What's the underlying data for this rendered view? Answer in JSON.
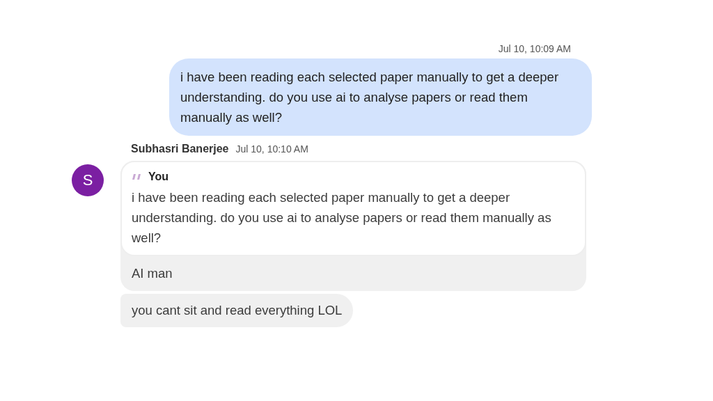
{
  "outgoing": {
    "time": "Jul 10, 10:09 AM",
    "text": "i have been reading each selected paper manually to get a deeper understanding. do you use ai to analyse papers or read them manually as well?"
  },
  "incoming": {
    "avatar_letter": "S",
    "sender": "Subhasri Banerjee",
    "time": "Jul 10, 10:10 AM",
    "quote": {
      "author": "You",
      "text": "i have been reading each selected paper manually to get a deeper understanding. do you use ai to analyse papers or read them manually as well?"
    },
    "messages": [
      "AI man",
      "you cant sit and read everything LOL"
    ]
  }
}
